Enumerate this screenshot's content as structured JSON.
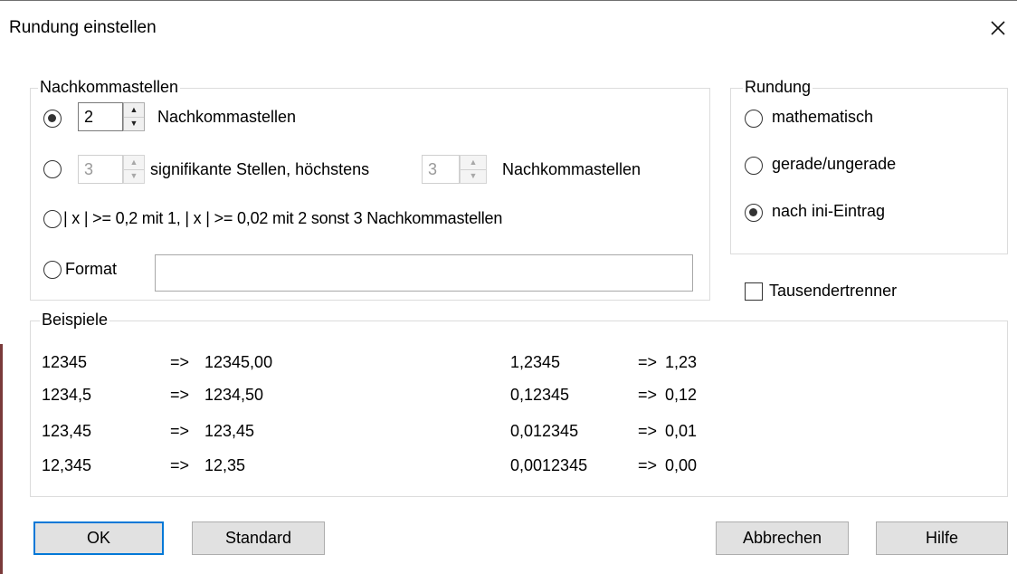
{
  "window": {
    "title": "Rundung einstellen",
    "close_glyph": "✕"
  },
  "nachkomma_group": {
    "legend": "Nachkommastellen",
    "option1": {
      "value": "2",
      "label": "Nachkommastellen",
      "checked": true
    },
    "option2": {
      "value1": "3",
      "label1": "signifikante Stellen, höchstens",
      "value2": "3",
      "label2": "Nachkommastellen",
      "checked": false
    },
    "option3": {
      "label": "| x | >= 0,2  mit 1, | x | >= 0,02 mit 2 sonst 3 Nachkommastellen",
      "checked": false
    },
    "option4": {
      "label": "Format",
      "value": "",
      "checked": false
    }
  },
  "rundung_group": {
    "legend": "Rundung",
    "options": [
      {
        "label": "mathematisch",
        "checked": false
      },
      {
        "label": "gerade/ungerade",
        "checked": false
      },
      {
        "label": "nach ini-Eintrag",
        "checked": true
      }
    ]
  },
  "tausender": {
    "label": "Tausendertrenner",
    "checked": false
  },
  "beispiele": {
    "legend": "Beispiele",
    "arrow": "=>",
    "left": [
      {
        "input": "12345",
        "output": "12345,00"
      },
      {
        "input": "1234,5",
        "output": "1234,50"
      },
      {
        "input": "123,45",
        "output": "123,45"
      },
      {
        "input": "12,345",
        "output": "12,35"
      }
    ],
    "right": [
      {
        "input": "1,2345",
        "output": "1,23"
      },
      {
        "input": "0,12345",
        "output": "0,12"
      },
      {
        "input": "0,012345",
        "output": "0,01"
      },
      {
        "input": "0,0012345",
        "output": "0,00"
      }
    ]
  },
  "buttons": {
    "ok": "OK",
    "standard": "Standard",
    "abbrechen": "Abbrechen",
    "hilfe": "Hilfe"
  },
  "colors": {
    "default_button_border": "#0078d7",
    "button_bg": "#e1e1e1",
    "group_border": "#dcdcdc"
  }
}
